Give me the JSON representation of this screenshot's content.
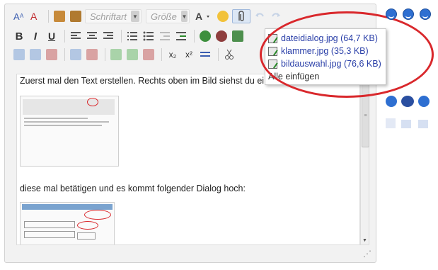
{
  "toolbar": {
    "font_combo": "Schriftart",
    "size_combo": "Größe",
    "bold": "B",
    "italic": "I",
    "underline": "U",
    "subscript": "x₂",
    "superscript": "x²"
  },
  "content": {
    "line1": "Zuerst mal den Text erstellen. Rechts oben im Bild siehst du ei",
    "line2": "diese mal betätigen und es kommt folgender Dialog hoch:"
  },
  "attachments_menu": {
    "items": [
      {
        "name": "dateidialog.jpg (64,7 KB)"
      },
      {
        "name": "klammer.jpg (35,3 KB)"
      },
      {
        "name": "bildauswahl.jpg (76,6 KB)"
      }
    ],
    "insert_all": "Alle einfügen"
  },
  "colors": {
    "highlight": "#d9282c",
    "link": "#2a3fa8",
    "editor_bg": "#f2f2f2"
  }
}
